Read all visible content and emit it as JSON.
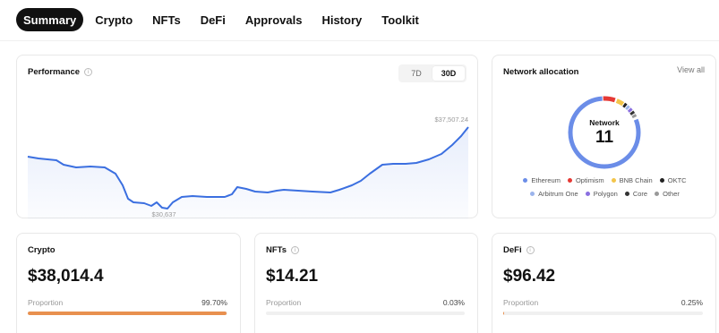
{
  "tabs": [
    "Summary",
    "Crypto",
    "NFTs",
    "DeFi",
    "Approvals",
    "History",
    "Toolkit"
  ],
  "active_tab": "Summary",
  "performance": {
    "title": "Performance",
    "ranges": [
      "7D",
      "30D"
    ],
    "active_range": "30D",
    "high_label": "$37,507.24",
    "low_label": "$30,637",
    "line_color": "#3b6fe0"
  },
  "network": {
    "title": "Network allocation",
    "view_all": "View all",
    "center_label": "Network",
    "center_value": "11",
    "legend": [
      {
        "name": "Ethereum",
        "color": "#6b8de8"
      },
      {
        "name": "Optimism",
        "color": "#e53935"
      },
      {
        "name": "BNB Chain",
        "color": "#f3c54a"
      },
      {
        "name": "OKTC",
        "color": "#222222"
      },
      {
        "name": "Arbitrum One",
        "color": "#9bb4ec"
      },
      {
        "name": "Polygon",
        "color": "#8a6fe0"
      },
      {
        "name": "Core",
        "color": "#333333"
      },
      {
        "name": "Other",
        "color": "#999999"
      }
    ]
  },
  "cards": {
    "crypto": {
      "title": "Crypto",
      "amount": "$38,014.4",
      "proportion_label": "Proportion",
      "proportion": "99.70%",
      "fill": 0.997
    },
    "nfts": {
      "title": "NFTs",
      "amount": "$14.21",
      "proportion_label": "Proportion",
      "proportion": "0.03%",
      "fill": 0.0003
    },
    "defi": {
      "title": "DeFi",
      "amount": "$96.42",
      "proportion_label": "Proportion",
      "proportion": "0.25%",
      "fill": 0.0025
    }
  }
}
